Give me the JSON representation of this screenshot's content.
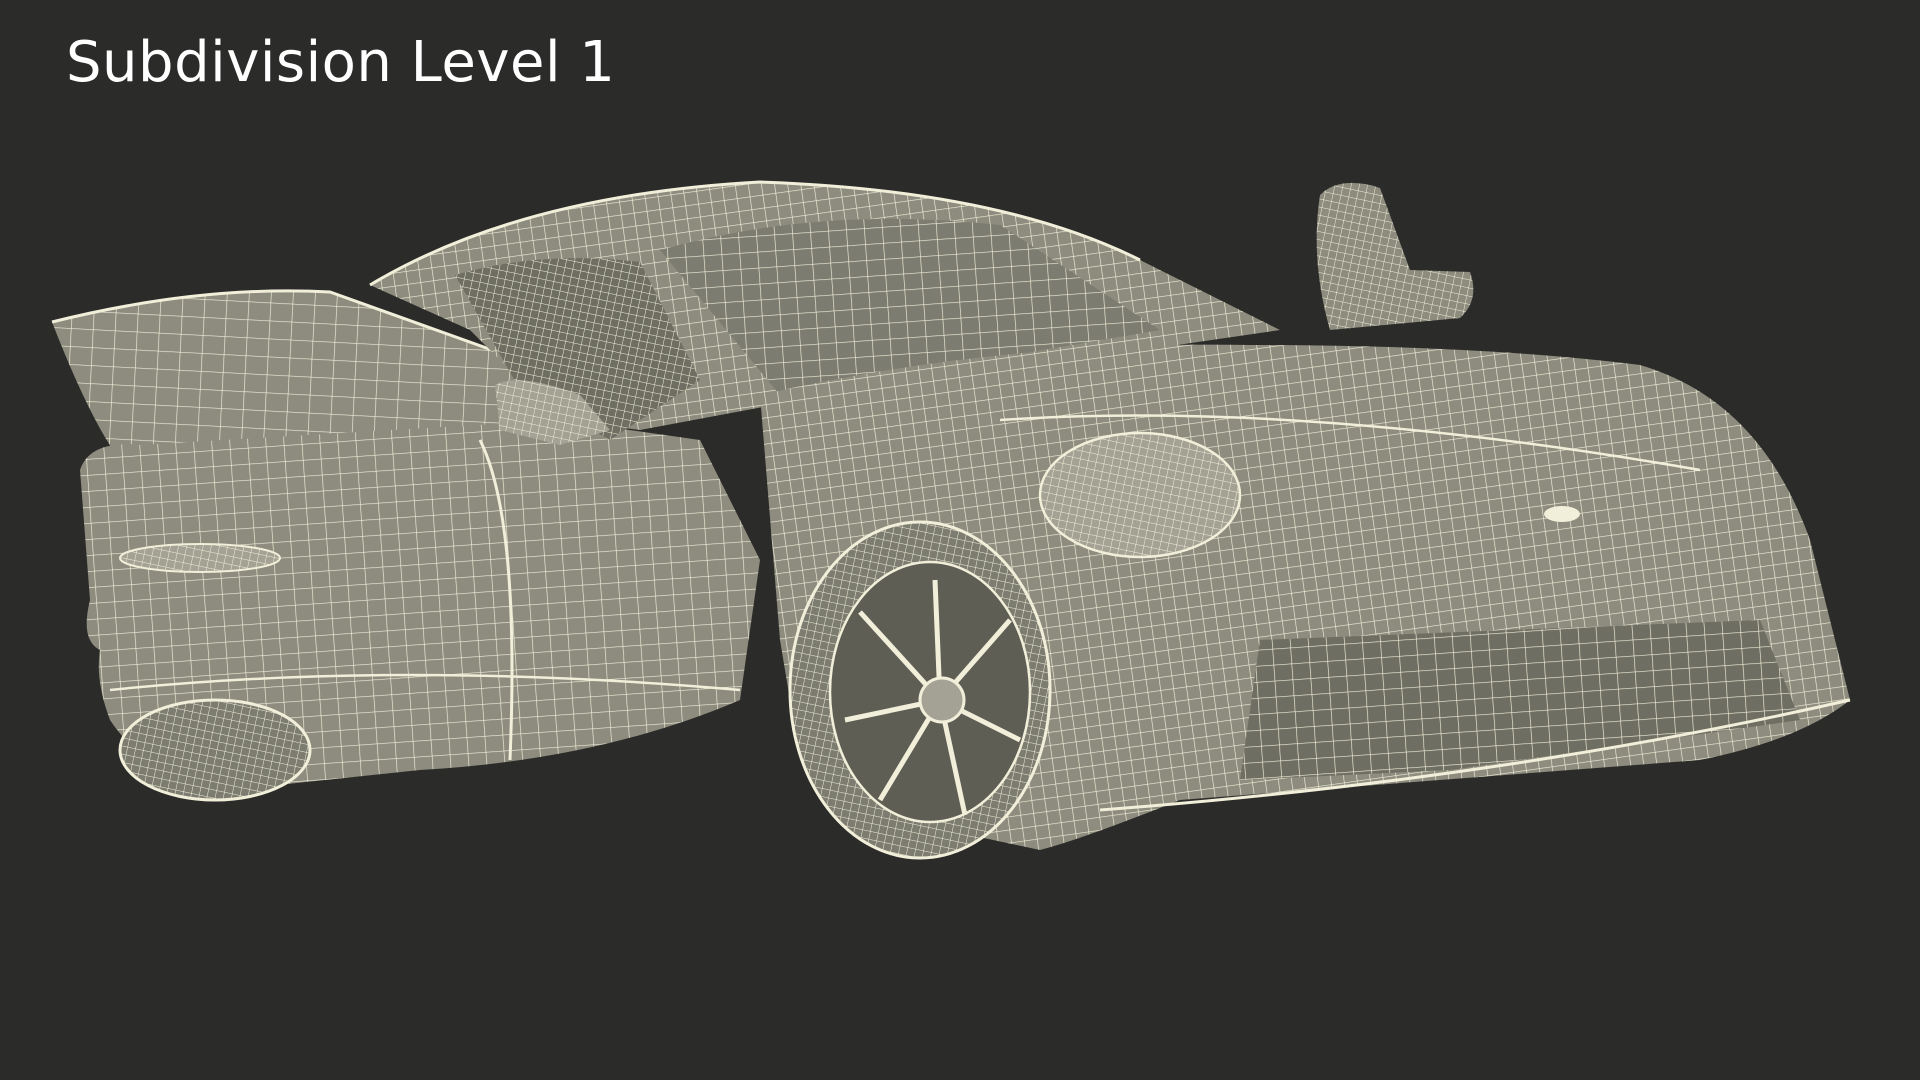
{
  "caption": {
    "text": "Subdivision Level 1"
  },
  "colors": {
    "background": "#2b2b2a",
    "caption_text": "#ffffff",
    "mesh_fill": "#8d8c7e",
    "mesh_fill_dark": "#6f6e62",
    "mesh_fill_light": "#a3a294",
    "wire_lines": "#f1efd9"
  },
  "subject": {
    "icon": "wireframe-sports-car"
  }
}
